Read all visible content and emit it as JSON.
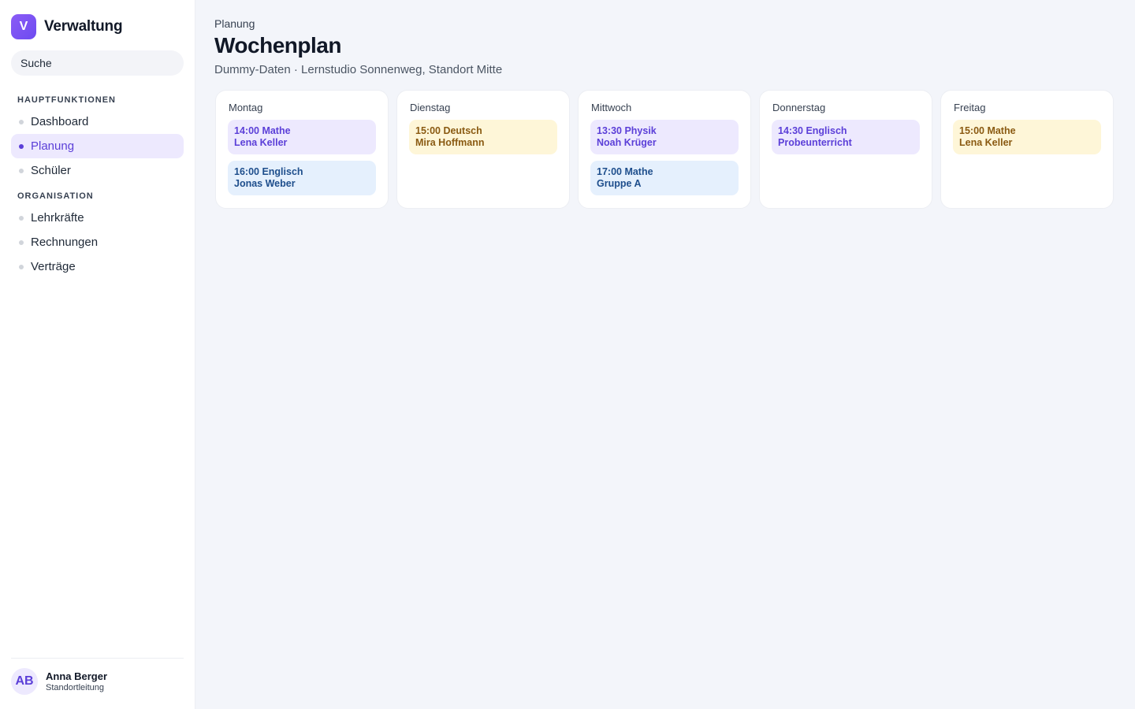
{
  "brand": {
    "logo_letter": "V",
    "name": "Verwaltung"
  },
  "search": {
    "placeholder": "Suche"
  },
  "nav": {
    "sections": [
      {
        "heading": "HAUPTFUNKTIONEN",
        "items": [
          "Dashboard",
          "Planung",
          "Schüler"
        ]
      },
      {
        "heading": "ORGANISATION",
        "items": [
          "Lehrkräfte",
          "Rechnungen",
          "Verträge"
        ]
      }
    ],
    "active": "Planung"
  },
  "user": {
    "initials": "AB",
    "name": "Anna Berger",
    "role": "Standortleitung"
  },
  "page": {
    "eyebrow": "Planung",
    "title": "Wochenplan",
    "subtitle": "Dummy-Daten · Lernstudio Sonnenweg, Standort Mitte"
  },
  "days": [
    {
      "name": "Montag",
      "events": [
        {
          "time_subject": "14:00 Mathe",
          "detail": "Lena Keller",
          "color": "purple"
        },
        {
          "time_subject": "16:00 Englisch",
          "detail": "Jonas Weber",
          "color": "blue"
        }
      ]
    },
    {
      "name": "Dienstag",
      "events": [
        {
          "time_subject": "15:00 Deutsch",
          "detail": "Mira Hoffmann",
          "color": "yellow"
        }
      ]
    },
    {
      "name": "Mittwoch",
      "events": [
        {
          "time_subject": "13:30 Physik",
          "detail": "Noah Krüger",
          "color": "purple"
        },
        {
          "time_subject": "17:00 Mathe",
          "detail": "Gruppe A",
          "color": "blue"
        }
      ]
    },
    {
      "name": "Donnerstag",
      "events": [
        {
          "time_subject": "14:30 Englisch",
          "detail": "Probeunterricht",
          "color": "purple"
        }
      ]
    },
    {
      "name": "Freitag",
      "events": [
        {
          "time_subject": "15:00 Mathe",
          "detail": "Lena Keller",
          "color": "yellow"
        }
      ]
    }
  ],
  "colors": {
    "accent": "#5b3fd8",
    "purple_bg": "#ede9fe",
    "yellow_bg": "#fef6d8",
    "blue_bg": "#e5f0fd"
  }
}
